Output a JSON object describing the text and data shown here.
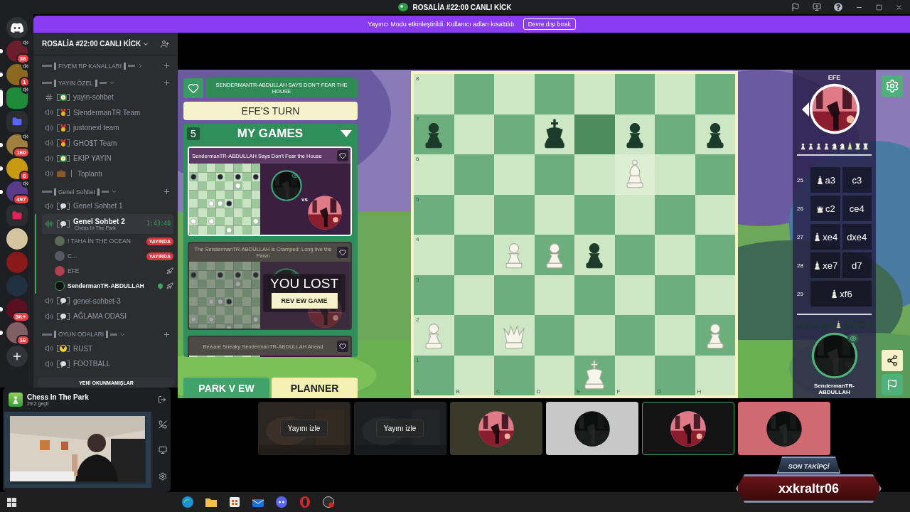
{
  "window": {
    "title": "ROSALİA #22:00 CANLI KİCK"
  },
  "banner": {
    "message": "Yayıncı Modu etkinleştirildi. Kullanıcı adları kısaltıldı.",
    "button": "Devre dışı bırak"
  },
  "servers": [
    {
      "kind": "home",
      "selected": false,
      "unread": false,
      "audio": false
    },
    {
      "kind": "server",
      "color": "#6b1f2a",
      "badge": "38",
      "audio": true,
      "selected": false,
      "unread": true
    },
    {
      "kind": "server",
      "color": "#8a6a20",
      "badge": "1",
      "audio": true,
      "selected": false,
      "unread": true
    },
    {
      "kind": "server",
      "color": "#1f8a3a",
      "audio": true,
      "selected": true
    },
    {
      "kind": "folder",
      "color": "#5865f2",
      "audio": false,
      "selected": false,
      "unread": false
    },
    {
      "kind": "server",
      "color": "#a08040",
      "badge": "160",
      "audio": true,
      "selected": false,
      "unread": true
    },
    {
      "kind": "server",
      "color": "#c89a10",
      "badge": "6",
      "audio": false,
      "selected": false,
      "unread": true
    },
    {
      "kind": "server",
      "color": "#5a3a8a",
      "badge": "497",
      "audio": true,
      "selected": false,
      "unread": true
    },
    {
      "kind": "folder",
      "color": "#e0245e",
      "audio": false,
      "selected": false,
      "unread": false
    },
    {
      "kind": "server",
      "color": "#d6c4a0",
      "audio": false,
      "selected": false,
      "unread": false
    },
    {
      "kind": "server",
      "color": "#8a1a1a",
      "audio": false,
      "selected": false,
      "unread": false
    },
    {
      "kind": "server",
      "color": "#203040",
      "audio": false,
      "selected": false,
      "unread": false
    },
    {
      "kind": "server",
      "color": "#5a1020",
      "badge": "5K+",
      "audio": false,
      "selected": false,
      "unread": true
    },
    {
      "kind": "server",
      "color": "#806060",
      "badge": "16",
      "audio": false,
      "selected": false,
      "unread": true
    },
    {
      "kind": "add",
      "audio": false,
      "selected": false,
      "unread": false
    }
  ],
  "sidebar": {
    "server_name": "ROSALİA #22:00 CANLI KİCK",
    "categories": [
      {
        "name": "FİVEM RP KANALLARI",
        "expanded": false
      },
      {
        "name": "YAYIN ÖZEL",
        "expanded": true,
        "channels": [
          {
            "kind": "text",
            "emblem": {
              "kind": "flower"
            },
            "framed": true,
            "name": "yayin-sohbet",
            "selected": false
          },
          {
            "kind": "voice",
            "emblem": {
              "kind": "medal"
            },
            "framed": true,
            "name": "SlendermanTR Team",
            "selected": false
          },
          {
            "kind": "voice",
            "emblem": {
              "kind": "medal"
            },
            "framed": true,
            "name": "justonexl team",
            "selected": false
          },
          {
            "kind": "voice",
            "emblem": {
              "kind": "medal"
            },
            "framed": true,
            "name": "GHO$T Team",
            "selected": false
          },
          {
            "kind": "voice",
            "emblem": {
              "kind": "flower"
            },
            "framed": true,
            "name": "EKIP YAYIN",
            "selected": false
          },
          {
            "kind": "voice",
            "emblem": {
              "kind": "briefcase"
            },
            "framed": false,
            "name": "Toplantı",
            "selected": false
          }
        ]
      },
      {
        "name": "Genel Sohbet",
        "expanded": true,
        "channels": [
          {
            "kind": "voice",
            "emblem": {
              "kind": "bubble"
            },
            "framed": true,
            "name": "Genel Sohbet 1",
            "selected": false
          },
          {
            "kind": "voice",
            "emblem": {
              "kind": "bubble"
            },
            "framed": true,
            "name": "Genel Sohbet 2",
            "selected": true,
            "timer": "1:43:40",
            "activity": "Chess In The Park",
            "members": [
              {
                "name": "! TAHA İN THE OCEAN",
                "color": "#5a6b55",
                "badge": "YAYINDA",
                "speaking": false,
                "boost": false,
                "shield": false
              },
              {
                "name": "C...",
                "color": "#555a60",
                "badge": "YAYINDA",
                "speaking": false,
                "boost": false,
                "shield": false
              },
              {
                "name": "EFE",
                "color": "#b04050",
                "speaking": false,
                "boost": true,
                "shield": false
              },
              {
                "name": "SendermanTR-ABDULLAH",
                "color": "#111111",
                "speaking": true,
                "boost": true,
                "shield": true
              }
            ]
          },
          {
            "kind": "voice",
            "emblem": {
              "kind": "bubble"
            },
            "framed": true,
            "name": "genel-sohbet-3",
            "selected": false
          },
          {
            "kind": "voice",
            "emblem": {
              "kind": "bubble"
            },
            "framed": true,
            "name": "AĞLAMA ODASI",
            "selected": false
          }
        ]
      },
      {
        "name": "OYUN ODALARI",
        "expanded": true,
        "channels": [
          {
            "kind": "voice",
            "emblem": {
              "kind": "radiation"
            },
            "framed": true,
            "name": "RUST",
            "selected": false
          },
          {
            "kind": "voice",
            "emblem": {
              "kind": "bubble"
            },
            "framed": true,
            "name": "FOOTBALL",
            "selected": false
          }
        ]
      }
    ],
    "unread_pill": "YENİ OKUNMAMIŞLAR"
  },
  "activity_panel": {
    "title": "Chess In The Park",
    "elapsed": "29:2 geçti"
  },
  "game": {
    "announcement": "SENDERMANTR-ABDULLAH SAYS DON'T FEAR THE HOUSE",
    "turn": "EFE'S TURN",
    "games_count": "5",
    "games_title": "MY GAMES",
    "games": [
      {
        "title": "SendermanTR-ABDULLAH Says Don't Fear the House",
        "selected": true,
        "vs": "vs"
      },
      {
        "title": "The SendermanTR-ABDULLAH is Cramped: Long live the Pawn",
        "selected": false,
        "result": "YOU LOST",
        "action": "REV EW GAME"
      },
      {
        "title": "Beware Sneaky SendermanTR-ABDULLAH Ahead",
        "selected": false
      }
    ],
    "tabs": [
      {
        "label": "PARK V EW",
        "selected": false
      },
      {
        "label": "PLANNER",
        "selected": true
      }
    ]
  },
  "board": {
    "ranks": [
      "8",
      "7",
      "6",
      "5",
      "4",
      "3",
      "2",
      "1"
    ],
    "files": [
      "A",
      "B",
      "C",
      "D",
      "E",
      "F",
      "G",
      "H"
    ],
    "rows": [
      [
        {
          "kind": "empty"
        },
        {
          "kind": "empty"
        },
        {
          "kind": "empty"
        },
        {
          "kind": "empty"
        },
        {
          "kind": "empty"
        },
        {
          "kind": "empty"
        },
        {
          "kind": "empty"
        },
        {
          "kind": "empty"
        }
      ],
      [
        {
          "kind": "pawn",
          "dark": true
        },
        {
          "kind": "empty"
        },
        {
          "kind": "empty"
        },
        {
          "kind": "king",
          "dark": true
        },
        {
          "kind": "empty",
          "color": "#4f8c5d"
        },
        {
          "kind": "pawn",
          "dark": true
        },
        {
          "kind": "empty"
        },
        {
          "kind": "pawn",
          "dark": true
        }
      ],
      [
        {
          "kind": "empty"
        },
        {
          "kind": "empty"
        },
        {
          "kind": "empty"
        },
        {
          "kind": "empty"
        },
        {
          "kind": "empty"
        },
        {
          "kind": "bishop",
          "dark": false,
          "color": "#dcefd2"
        },
        {
          "kind": "empty"
        },
        {
          "kind": "empty"
        }
      ],
      [
        {
          "kind": "empty"
        },
        {
          "kind": "empty"
        },
        {
          "kind": "empty"
        },
        {
          "kind": "empty"
        },
        {
          "kind": "empty"
        },
        {
          "kind": "empty"
        },
        {
          "kind": "empty"
        },
        {
          "kind": "empty"
        }
      ],
      [
        {
          "kind": "empty"
        },
        {
          "kind": "empty"
        },
        {
          "kind": "pawn",
          "dark": false
        },
        {
          "kind": "pawn",
          "dark": false
        },
        {
          "kind": "pawn",
          "dark": true
        },
        {
          "kind": "empty"
        },
        {
          "kind": "empty"
        },
        {
          "kind": "empty"
        }
      ],
      [
        {
          "kind": "empty"
        },
        {
          "kind": "empty"
        },
        {
          "kind": "empty"
        },
        {
          "kind": "empty"
        },
        {
          "kind": "empty"
        },
        {
          "kind": "empty"
        },
        {
          "kind": "empty"
        },
        {
          "kind": "empty"
        }
      ],
      [
        {
          "kind": "pawn",
          "dark": false
        },
        {
          "kind": "empty"
        },
        {
          "kind": "queen",
          "dark": false
        },
        {
          "kind": "empty"
        },
        {
          "kind": "empty"
        },
        {
          "kind": "empty"
        },
        {
          "kind": "empty"
        },
        {
          "kind": "pawn",
          "dark": false
        }
      ],
      [
        {
          "kind": "empty"
        },
        {
          "kind": "empty"
        },
        {
          "kind": "empty"
        },
        {
          "kind": "empty"
        },
        {
          "kind": "king",
          "dark": false
        },
        {
          "kind": "empty"
        },
        {
          "kind": "empty"
        },
        {
          "kind": "empty"
        }
      ]
    ]
  },
  "players": {
    "top": {
      "name": "EFE",
      "captured": [
        {
          "kind": "pawn",
          "recent": false
        },
        {
          "kind": "pawn",
          "recent": false
        },
        {
          "kind": "pawn",
          "recent": false
        },
        {
          "kind": "pawn",
          "recent": false
        },
        {
          "kind": "knight",
          "recent": false
        },
        {
          "kind": "knight",
          "recent": false
        },
        {
          "kind": "bishop",
          "recent": true
        },
        {
          "kind": "rook",
          "recent": false
        },
        {
          "kind": "rook",
          "recent": false
        }
      ]
    },
    "bottom": {
      "name": "SendermanTR-ABDULLAH",
      "captured": [
        {
          "kind": "pawn",
          "recent": false
        },
        {
          "kind": "pawn",
          "recent": false
        },
        {
          "kind": "pawn",
          "recent": false
        },
        {
          "kind": "pawn",
          "recent": false
        },
        {
          "kind": "knight",
          "recent": false
        },
        {
          "kind": "bishop",
          "recent": true
        },
        {
          "kind": "bishop",
          "recent": false
        },
        {
          "kind": "rook",
          "recent": false
        },
        {
          "kind": "rook",
          "recent": false
        },
        {
          "kind": "rook",
          "recent": false
        }
      ]
    }
  },
  "moves": [
    {
      "number": "25",
      "white": {
        "kind": "bishop",
        "text": "a3"
      },
      "black": {
        "text": "c3"
      }
    },
    {
      "number": "26",
      "white": {
        "kind": "queen",
        "text": "c2"
      },
      "black": {
        "text": "ce4"
      }
    },
    {
      "number": "27",
      "white": {
        "kind": "bishop",
        "text": "xe4"
      },
      "black": {
        "text": "dxe4"
      }
    },
    {
      "number": "28",
      "white": {
        "kind": "bishop",
        "text": "xe7"
      },
      "black": {
        "text": "d7"
      }
    },
    {
      "number": "29",
      "white": {
        "kind": "bishop",
        "text": "xf6"
      }
    }
  ],
  "tiles": [
    {
      "kind": "stream",
      "action": "Yayını izle",
      "selected": false
    },
    {
      "kind": "stream",
      "action": "Yayını izle",
      "selected": false
    },
    {
      "kind": "avatar",
      "color": "#3a3a2a",
      "selected": false
    },
    {
      "kind": "avatar",
      "color": "#c8c8c8",
      "selected": false
    },
    {
      "kind": "avatar",
      "color": "#141414",
      "selected": true
    },
    {
      "kind": "avatar",
      "color": "#d06a70",
      "selected": false
    }
  ],
  "follower_overlay": {
    "label": "SON TAKİPÇİ",
    "name": "xxkraltr06"
  }
}
